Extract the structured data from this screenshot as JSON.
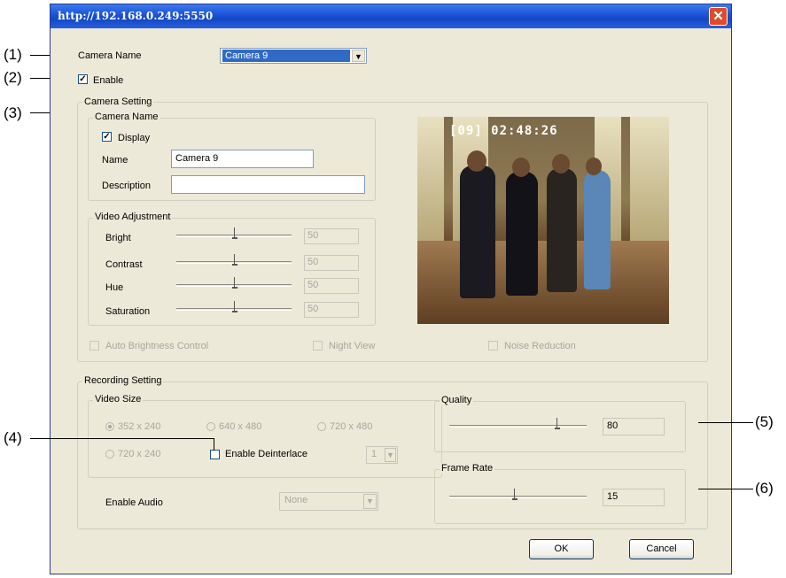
{
  "window": {
    "title": "http://192.168.0.249:5550",
    "close_glyph": "✕"
  },
  "callouts": [
    "(1)",
    "(2)",
    "(3)",
    "(4)",
    "(5)",
    "(6)"
  ],
  "camera_name_row": {
    "label": "Camera Name",
    "selected": "Camera 9"
  },
  "enable": {
    "label": "Enable",
    "checked": true
  },
  "camera_setting": {
    "group_label": "Camera Setting",
    "camera_name_group": {
      "label": "Camera Name",
      "display_label": "Display",
      "display_checked": true,
      "name_label": "Name",
      "name_value": "Camera 9",
      "description_label": "Description",
      "description_value": ""
    },
    "video_adjustment": {
      "label": "Video Adjustment",
      "rows": [
        {
          "label": "Bright",
          "value": "50",
          "level": 0.5
        },
        {
          "label": "Contrast",
          "value": "50",
          "level": 0.5
        },
        {
          "label": "Hue",
          "value": "50",
          "level": 0.5
        },
        {
          "label": "Saturation",
          "value": "50",
          "level": 0.5
        }
      ]
    },
    "preview": {
      "timestamp": "[09] 02:48:26"
    },
    "auto_brightness_label": "Auto Brightness Control",
    "night_view_label": "Night View",
    "noise_reduction_label": "Noise Reduction"
  },
  "recording_setting": {
    "group_label": "Recording Setting",
    "video_size": {
      "label": "Video Size",
      "options": [
        "352 x 240",
        "640 x 480",
        "720 x 480",
        "720 x 240"
      ],
      "selected": "352 x 240",
      "deinterlace_label": "Enable Deinterlace",
      "deinterlace_value": "1"
    },
    "enable_audio_label": "Enable Audio",
    "audio_value": "None",
    "quality": {
      "label": "Quality",
      "value": "80",
      "level": 0.8
    },
    "frame_rate": {
      "label": "Frame Rate",
      "value": "15",
      "level": 0.5
    }
  },
  "buttons": {
    "ok": "OK",
    "cancel": "Cancel"
  },
  "colors": {
    "titlebar": "#1f55d6",
    "dialog_bg": "#ece9d8",
    "close": "#e04a28"
  }
}
